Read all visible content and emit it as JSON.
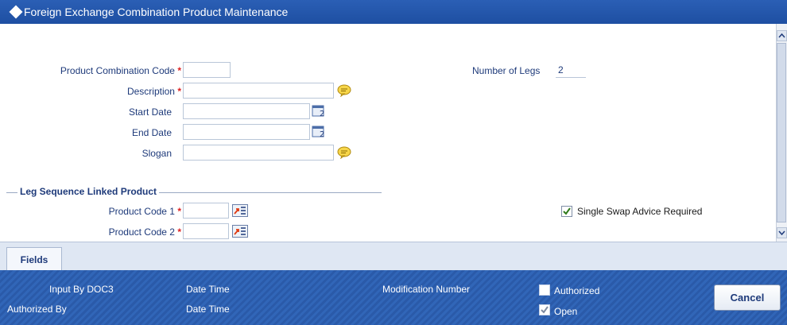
{
  "window": {
    "title": "Foreign Exchange Combination Product Maintenance"
  },
  "form": {
    "product_combination_code": {
      "label": "Product Combination Code",
      "required": "*",
      "value": ""
    },
    "description": {
      "label": "Description",
      "required": "*",
      "value": ""
    },
    "start_date": {
      "label": "Start Date",
      "value": ""
    },
    "end_date": {
      "label": "End Date",
      "value": ""
    },
    "slogan": {
      "label": "Slogan",
      "value": ""
    },
    "number_of_legs": {
      "label": "Number of Legs",
      "value": "2"
    }
  },
  "leg_section": {
    "title": "Leg Sequence Linked Product",
    "product_code_1": {
      "label": "Product Code 1",
      "required": "*",
      "value": ""
    },
    "product_code_2": {
      "label": "Product Code 2",
      "required": "*",
      "value": ""
    },
    "single_swap_advice": {
      "label": "Single Swap Advice Required",
      "checked": true
    }
  },
  "tabs": [
    "Fields"
  ],
  "footer": {
    "input_by": "Input By DOC3",
    "authorized_by": "Authorized By",
    "date_time_1": "Date Time",
    "date_time_2": "Date Time",
    "modification_number": "Modification Number",
    "authorized": {
      "label": "Authorized",
      "checked": false
    },
    "open": {
      "label": "Open",
      "checked": true
    },
    "cancel_label": "Cancel"
  },
  "icons": {
    "title": "diamond-icon",
    "text_edit": "speech-bubble-icon",
    "calendar": "calendar-icon",
    "lov": "list-of-values-icon",
    "check": "checkmark-icon",
    "scroll_up": "chevron-up-icon",
    "scroll_down": "chevron-down-icon"
  },
  "colors": {
    "title_bar": "#1e4fa2",
    "footer": "#2a5aa9",
    "required": "#dd2222",
    "label": "#1e3a7a"
  }
}
